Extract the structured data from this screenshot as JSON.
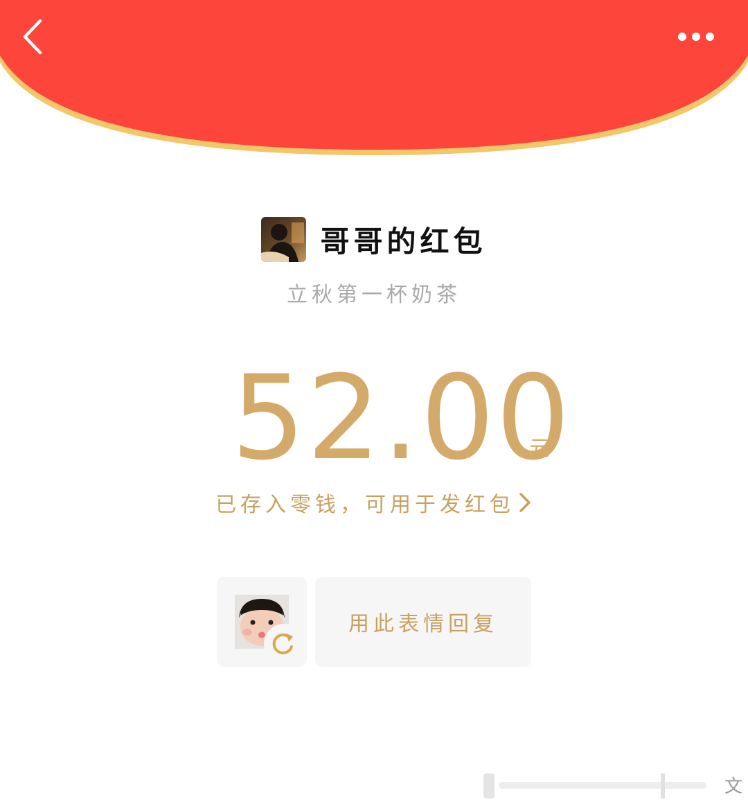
{
  "colors": {
    "header_red": "#fd453b",
    "header_border": "#f1c76a",
    "gold_text": "#d4aa6a",
    "muted_text": "#a9a9a9",
    "panel_bg": "#f6f6f6"
  },
  "nav": {
    "back_icon": "chevron-left-icon",
    "more_icon": "more-dots-icon"
  },
  "sender": {
    "name": "哥哥的红包",
    "avatar": "sender-avatar-photo"
  },
  "blessing": "立秋第一杯奶茶",
  "amount": {
    "value": "52.00",
    "unit": "元"
  },
  "note": {
    "text": "已存入零钱，可用于发红包",
    "icon": "chevron-right-icon"
  },
  "reply": {
    "sticker": "baby-sticker-image",
    "refresh_icon": "refresh-icon",
    "button_label": "用此表情回复"
  },
  "watermark": {
    "text": "文"
  }
}
